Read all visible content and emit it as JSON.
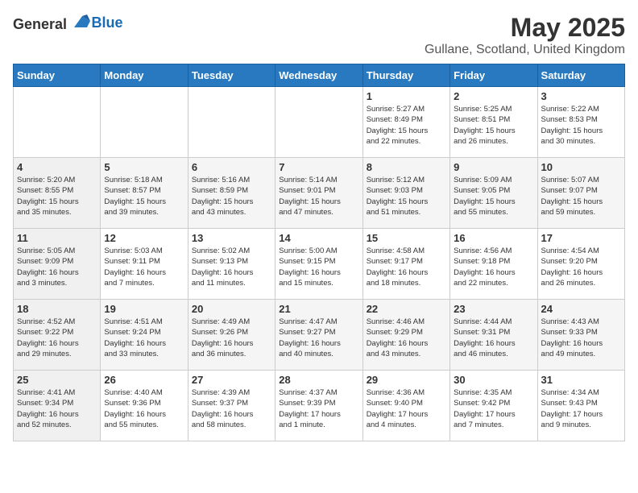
{
  "header": {
    "logo_general": "General",
    "logo_blue": "Blue",
    "month_year": "May 2025",
    "location": "Gullane, Scotland, United Kingdom"
  },
  "weekdays": [
    "Sunday",
    "Monday",
    "Tuesday",
    "Wednesday",
    "Thursday",
    "Friday",
    "Saturday"
  ],
  "weeks": [
    [
      {
        "num": "",
        "info": ""
      },
      {
        "num": "",
        "info": ""
      },
      {
        "num": "",
        "info": ""
      },
      {
        "num": "",
        "info": ""
      },
      {
        "num": "1",
        "info": "Sunrise: 5:27 AM\nSunset: 8:49 PM\nDaylight: 15 hours\nand 22 minutes."
      },
      {
        "num": "2",
        "info": "Sunrise: 5:25 AM\nSunset: 8:51 PM\nDaylight: 15 hours\nand 26 minutes."
      },
      {
        "num": "3",
        "info": "Sunrise: 5:22 AM\nSunset: 8:53 PM\nDaylight: 15 hours\nand 30 minutes."
      }
    ],
    [
      {
        "num": "4",
        "info": "Sunrise: 5:20 AM\nSunset: 8:55 PM\nDaylight: 15 hours\nand 35 minutes."
      },
      {
        "num": "5",
        "info": "Sunrise: 5:18 AM\nSunset: 8:57 PM\nDaylight: 15 hours\nand 39 minutes."
      },
      {
        "num": "6",
        "info": "Sunrise: 5:16 AM\nSunset: 8:59 PM\nDaylight: 15 hours\nand 43 minutes."
      },
      {
        "num": "7",
        "info": "Sunrise: 5:14 AM\nSunset: 9:01 PM\nDaylight: 15 hours\nand 47 minutes."
      },
      {
        "num": "8",
        "info": "Sunrise: 5:12 AM\nSunset: 9:03 PM\nDaylight: 15 hours\nand 51 minutes."
      },
      {
        "num": "9",
        "info": "Sunrise: 5:09 AM\nSunset: 9:05 PM\nDaylight: 15 hours\nand 55 minutes."
      },
      {
        "num": "10",
        "info": "Sunrise: 5:07 AM\nSunset: 9:07 PM\nDaylight: 15 hours\nand 59 minutes."
      }
    ],
    [
      {
        "num": "11",
        "info": "Sunrise: 5:05 AM\nSunset: 9:09 PM\nDaylight: 16 hours\nand 3 minutes."
      },
      {
        "num": "12",
        "info": "Sunrise: 5:03 AM\nSunset: 9:11 PM\nDaylight: 16 hours\nand 7 minutes."
      },
      {
        "num": "13",
        "info": "Sunrise: 5:02 AM\nSunset: 9:13 PM\nDaylight: 16 hours\nand 11 minutes."
      },
      {
        "num": "14",
        "info": "Sunrise: 5:00 AM\nSunset: 9:15 PM\nDaylight: 16 hours\nand 15 minutes."
      },
      {
        "num": "15",
        "info": "Sunrise: 4:58 AM\nSunset: 9:17 PM\nDaylight: 16 hours\nand 18 minutes."
      },
      {
        "num": "16",
        "info": "Sunrise: 4:56 AM\nSunset: 9:18 PM\nDaylight: 16 hours\nand 22 minutes."
      },
      {
        "num": "17",
        "info": "Sunrise: 4:54 AM\nSunset: 9:20 PM\nDaylight: 16 hours\nand 26 minutes."
      }
    ],
    [
      {
        "num": "18",
        "info": "Sunrise: 4:52 AM\nSunset: 9:22 PM\nDaylight: 16 hours\nand 29 minutes."
      },
      {
        "num": "19",
        "info": "Sunrise: 4:51 AM\nSunset: 9:24 PM\nDaylight: 16 hours\nand 33 minutes."
      },
      {
        "num": "20",
        "info": "Sunrise: 4:49 AM\nSunset: 9:26 PM\nDaylight: 16 hours\nand 36 minutes."
      },
      {
        "num": "21",
        "info": "Sunrise: 4:47 AM\nSunset: 9:27 PM\nDaylight: 16 hours\nand 40 minutes."
      },
      {
        "num": "22",
        "info": "Sunrise: 4:46 AM\nSunset: 9:29 PM\nDaylight: 16 hours\nand 43 minutes."
      },
      {
        "num": "23",
        "info": "Sunrise: 4:44 AM\nSunset: 9:31 PM\nDaylight: 16 hours\nand 46 minutes."
      },
      {
        "num": "24",
        "info": "Sunrise: 4:43 AM\nSunset: 9:33 PM\nDaylight: 16 hours\nand 49 minutes."
      }
    ],
    [
      {
        "num": "25",
        "info": "Sunrise: 4:41 AM\nSunset: 9:34 PM\nDaylight: 16 hours\nand 52 minutes."
      },
      {
        "num": "26",
        "info": "Sunrise: 4:40 AM\nSunset: 9:36 PM\nDaylight: 16 hours\nand 55 minutes."
      },
      {
        "num": "27",
        "info": "Sunrise: 4:39 AM\nSunset: 9:37 PM\nDaylight: 16 hours\nand 58 minutes."
      },
      {
        "num": "28",
        "info": "Sunrise: 4:37 AM\nSunset: 9:39 PM\nDaylight: 17 hours\nand 1 minute."
      },
      {
        "num": "29",
        "info": "Sunrise: 4:36 AM\nSunset: 9:40 PM\nDaylight: 17 hours\nand 4 minutes."
      },
      {
        "num": "30",
        "info": "Sunrise: 4:35 AM\nSunset: 9:42 PM\nDaylight: 17 hours\nand 7 minutes."
      },
      {
        "num": "31",
        "info": "Sunrise: 4:34 AM\nSunset: 9:43 PM\nDaylight: 17 hours\nand 9 minutes."
      }
    ]
  ]
}
